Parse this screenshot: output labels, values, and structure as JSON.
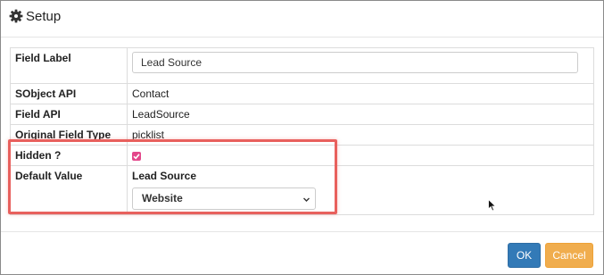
{
  "dialog": {
    "title": "Setup",
    "icon": "gear-icon"
  },
  "fields": {
    "field_label": {
      "label": "Field Label",
      "value": "Lead Source"
    },
    "sobject_api": {
      "label": "SObject API",
      "value": "Contact"
    },
    "field_api": {
      "label": "Field API",
      "value": "LeadSource"
    },
    "original_field_type": {
      "label": "Original Field Type",
      "value": "picklist"
    },
    "hidden": {
      "label": "Hidden ?",
      "checked": true
    },
    "default_value": {
      "label": "Default Value",
      "sub_label": "Lead Source",
      "selected": "Website"
    }
  },
  "footer": {
    "ok_label": "OK",
    "cancel_label": "Cancel"
  },
  "colors": {
    "ok": "#337ab7",
    "cancel": "#f0ad4e",
    "checkbox": "#e3478a",
    "highlight": "#e8605d"
  }
}
